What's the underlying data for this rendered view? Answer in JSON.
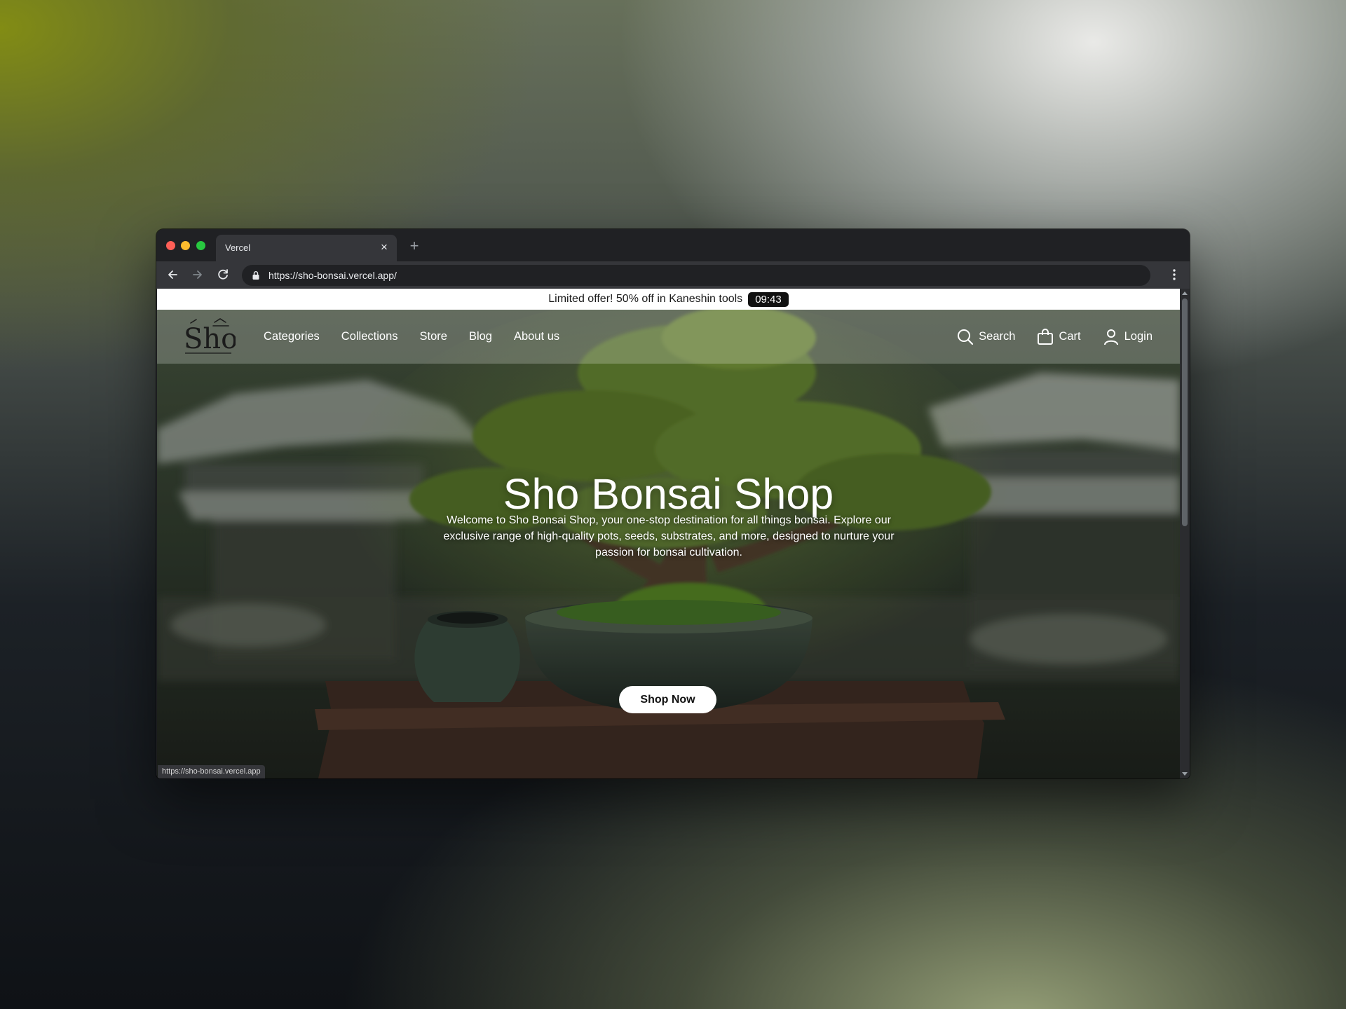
{
  "browser": {
    "tab_title": "Vercel",
    "tab_close": "×",
    "new_tab": "+",
    "url": "https://sho-bonsai.vercel.app/",
    "status_url": "https://sho-bonsai.vercel.app"
  },
  "promo": {
    "text": "Limited offer! 50% off in Kaneshin tools",
    "timer": "09:43"
  },
  "nav": {
    "logo_text": "Sho",
    "links": [
      "Categories",
      "Collections",
      "Store",
      "Blog",
      "About us"
    ],
    "search": "Search",
    "cart": "Cart",
    "login": "Login"
  },
  "hero": {
    "title": "Sho Bonsai Shop",
    "description": "Welcome to Sho Bonsai Shop, your one-stop destination for all things bonsai. Explore our exclusive range of high-quality pots, seeds, substrates, and more, designed to nurture your passion for bonsai cultivation.",
    "cta": "Shop Now"
  },
  "colors": {
    "promo_bg": "#ffffff",
    "timer_bg": "#111111",
    "cta_bg": "#ffffff",
    "browser_frame": "#202124"
  }
}
